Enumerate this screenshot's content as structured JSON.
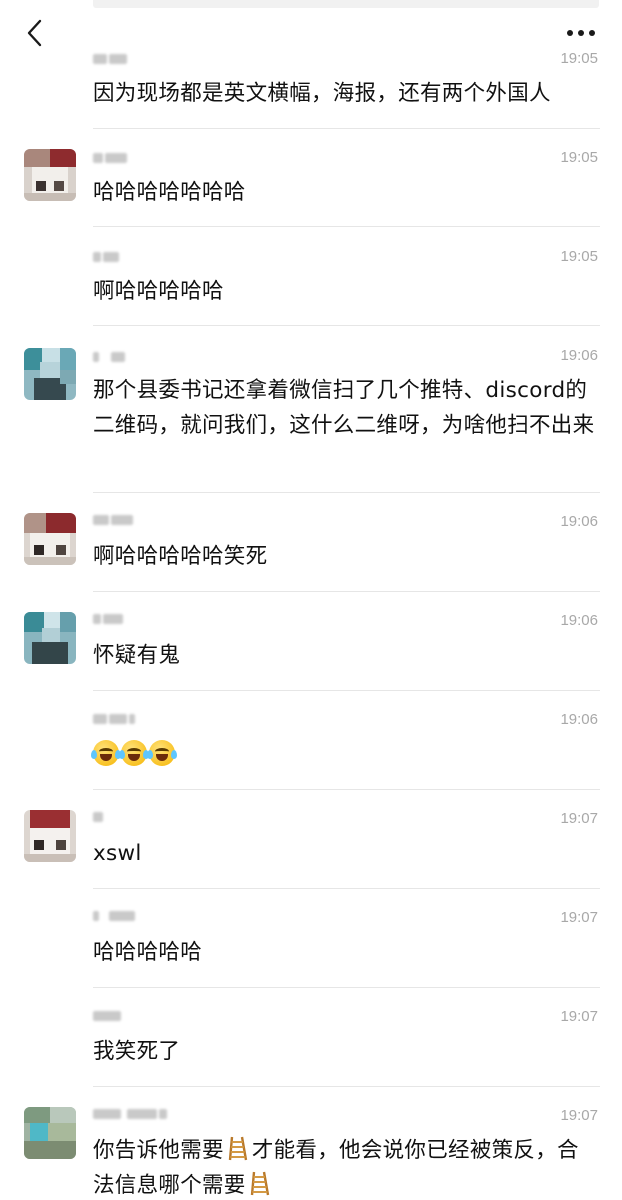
{
  "header": {
    "back_icon": "chevron-left-icon",
    "more_icon": "more-horizontal-icon"
  },
  "messages": [
    {
      "time": "19:05",
      "text": "因为现场都是英文横幅，海报，还有两个外国人",
      "avatar": "none"
    },
    {
      "time": "19:05",
      "text": "哈哈哈哈哈哈哈",
      "avatar": "red-white"
    },
    {
      "time": "19:05",
      "text": "啊哈哈哈哈哈",
      "avatar": "none"
    },
    {
      "time": "19:06",
      "text": "那个县委书记还拿着微信扫了几个推特、discord的二维码，就问我们，这什么二维呀，为啥他扫不出来",
      "avatar": "teal"
    },
    {
      "time": "19:06",
      "text": "啊哈哈哈哈哈笑死",
      "avatar": "red-white"
    },
    {
      "time": "19:06",
      "text": "怀疑有鬼",
      "avatar": "teal"
    },
    {
      "time": "19:06",
      "text": "",
      "emoji": [
        "joy-icon",
        "joy-icon",
        "joy-icon"
      ],
      "avatar": "none"
    },
    {
      "time": "19:07",
      "text": "xswl",
      "avatar": "red-white"
    },
    {
      "time": "19:07",
      "text": "哈哈哈哈哈",
      "avatar": "none"
    },
    {
      "time": "19:07",
      "text": "我笑死了",
      "avatar": "none"
    },
    {
      "time": "19:07",
      "text_parts": [
        "你告诉他需要",
        "才能看，他会说你已经被策反，合法信息哪个需要"
      ],
      "avatar": "olive-teal"
    }
  ]
}
